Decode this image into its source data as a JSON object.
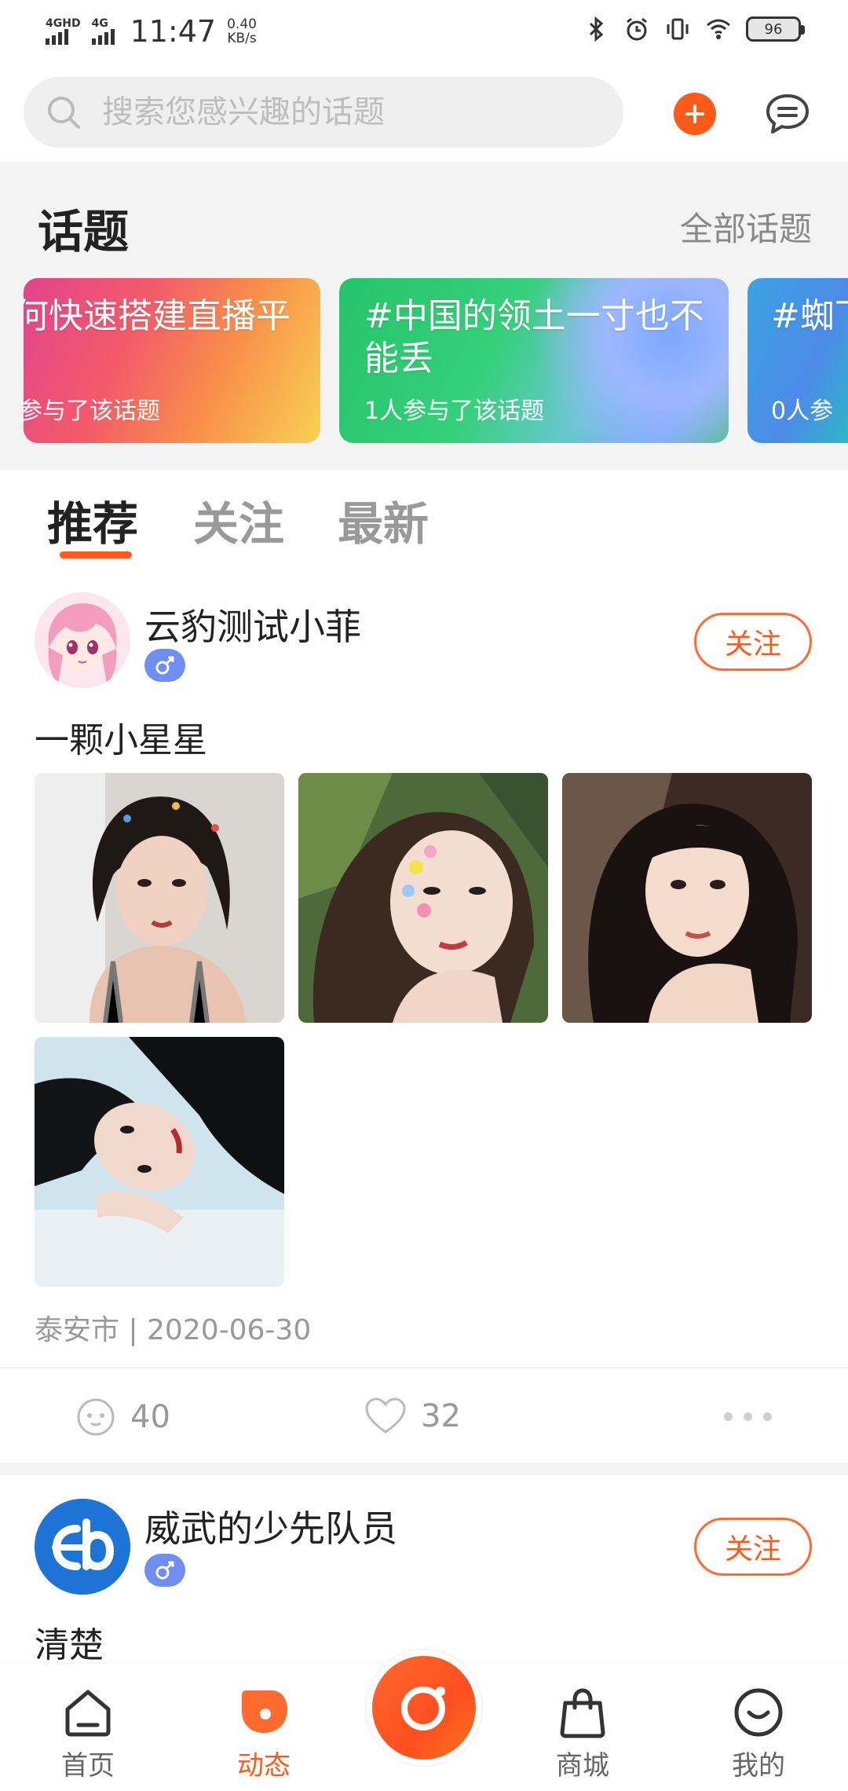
{
  "status_bar": {
    "network_1": "4GHD",
    "network_2": "4G",
    "time": "11:47",
    "speed_value": "0.40",
    "speed_unit": "KB/s",
    "battery": "96"
  },
  "header": {
    "search_placeholder": "搜索您感兴趣的话题"
  },
  "topics": {
    "title": "话题",
    "all_label": "全部话题",
    "cards": [
      {
        "title": "何快速搭建直播平",
        "count": "参与了该话题"
      },
      {
        "title": "#中国的领土一寸也不能丢",
        "count": "1人参与了该话题"
      },
      {
        "title": "#蜘下来",
        "count": "0人参"
      }
    ]
  },
  "feed_tabs": [
    "推荐",
    "关注",
    "最新"
  ],
  "posts": [
    {
      "username": "云豹测试小菲",
      "gender": "♂",
      "follow_label": "关注",
      "text": "一颗小星星",
      "meta": "泰安市 | 2020-06-30",
      "comments": "40",
      "likes": "32"
    },
    {
      "username": "威武的少先队员",
      "gender": "♂",
      "follow_label": "关注",
      "text": "清楚"
    }
  ],
  "bottom_nav": {
    "home": "首页",
    "dynamic": "动态",
    "mall": "商城",
    "mine": "我的"
  },
  "colors": {
    "accent": "#ff5a1a",
    "badge": "#6f8ef2"
  }
}
